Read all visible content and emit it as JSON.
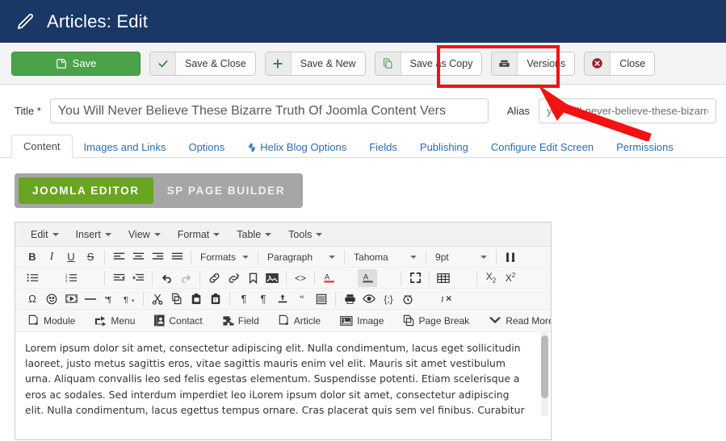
{
  "header": {
    "title": "Articles: Edit",
    "icon": "pencil-icon"
  },
  "toolbar": {
    "save_label": "Save",
    "save_close_label": "Save & Close",
    "save_new_label": "Save & New",
    "save_copy_label": "Save as Copy",
    "versions_label": "Versions",
    "close_label": "Close",
    "highlight_color": "#f21212",
    "save_button_color": "#4ba24b"
  },
  "form": {
    "title_label": "Title *",
    "title_value": "You Will Never Believe These Bizarre Truth Of Joomla Content Vers",
    "alias_label": "Alias",
    "alias_value": "you-will-never-believe-these-bizarre"
  },
  "tabs": [
    {
      "label": "Content",
      "active": true
    },
    {
      "label": "Images and Links",
      "active": false
    },
    {
      "label": "Options",
      "active": false
    },
    {
      "label": "Helix Blog Options",
      "active": false,
      "icon": "joomla-icon"
    },
    {
      "label": "Fields",
      "active": false
    },
    {
      "label": "Publishing",
      "active": false
    },
    {
      "label": "Configure Edit Screen",
      "active": false
    },
    {
      "label": "Permissions",
      "active": false
    }
  ],
  "editor_switch": {
    "joomla_editor_label": "JOOMLA EDITOR",
    "sp_page_builder_label": "SP PAGE BUILDER",
    "active_color": "#6aa521",
    "track_color": "#a6a6a6"
  },
  "editor": {
    "menubar": [
      "Edit",
      "Insert",
      "View",
      "Format",
      "Table",
      "Tools"
    ],
    "selects": {
      "paragraph": "Paragraph",
      "font": "Tahoma",
      "size": "9pt"
    },
    "plugin_buttons": [
      {
        "label": "Module",
        "icon": "module-icon"
      },
      {
        "label": "Menu",
        "icon": "menu-icon"
      },
      {
        "label": "Contact",
        "icon": "contact-icon"
      },
      {
        "label": "Field",
        "icon": "field-icon"
      },
      {
        "label": "Article",
        "icon": "article-icon"
      },
      {
        "label": "Image",
        "icon": "image-icon"
      },
      {
        "label": "Page Break",
        "icon": "page-break-icon"
      },
      {
        "label": "Read More",
        "icon": "read-more-icon"
      }
    ],
    "content_paragraph": "Lorem ipsum dolor sit amet, consectetur adipiscing elit. Nulla condimentum, lacus eget sollicitudin laoreet, justo metus sagittis eros, vitae sagittis mauris enim vel elit. Mauris sit amet vestibulum urna. Aliquam convallis leo sed felis egestas elementum. Suspendisse potenti. Etiam scelerisque a eros ac sodales. Sed interdum imperdiet leo iLorem ipsum dolor sit amet, consectetur adipiscing elit. Nulla condimentum, lacus egettus tempus ornare. Cras placerat quis sem vel finibus. Curabitur tempus lobortis dolor, in fermentum ipsum."
  }
}
